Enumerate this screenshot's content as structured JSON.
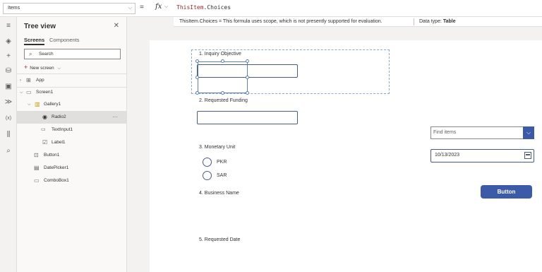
{
  "formula_bar": {
    "property": "Items",
    "equals": "=",
    "fx": "fx",
    "formula_part1": "ThisItem",
    "formula_part2": ".Choices"
  },
  "hint_bar": {
    "message": "ThisItem.Choices  =  This formula uses scope, which is not presently supported for evaluation.",
    "data_type_label": "Data type: ",
    "data_type_value": "Table"
  },
  "rail_icons": [
    "menu-icon",
    "layers-icon",
    "plus-icon",
    "data-icon",
    "media-icon",
    "flow-icon",
    "variables-icon",
    "tools-icon",
    "search-icon"
  ],
  "tree": {
    "title": "Tree view",
    "tabs": {
      "screens": "Screens",
      "components": "Components"
    },
    "search_placeholder": "Search",
    "new_screen": "New screen",
    "items": {
      "app": "App",
      "screen1": "Screen1",
      "gallery1": "Gallery1",
      "radio2": "Radio2",
      "textinput1": "TextInput1",
      "label1": "Label1",
      "button1": "Button1",
      "datepicker1": "DatePicker1",
      "combobox1": "ComboBox1"
    },
    "more": "···"
  },
  "canvas": {
    "q1": "1. Inquiry Objective",
    "q2": "2. Requested Funding",
    "q3": "3. Monetary Unit",
    "opt1": "PKR",
    "opt2": "SAR",
    "q4": "4. Business Name",
    "q5": "5. Requested Date",
    "find_placeholder": "Find items",
    "date_value": "10/13/2023",
    "button_label": "Button"
  },
  "colors": {
    "accent": "#3b5aa8",
    "formula_keyword": "#a4262c"
  }
}
